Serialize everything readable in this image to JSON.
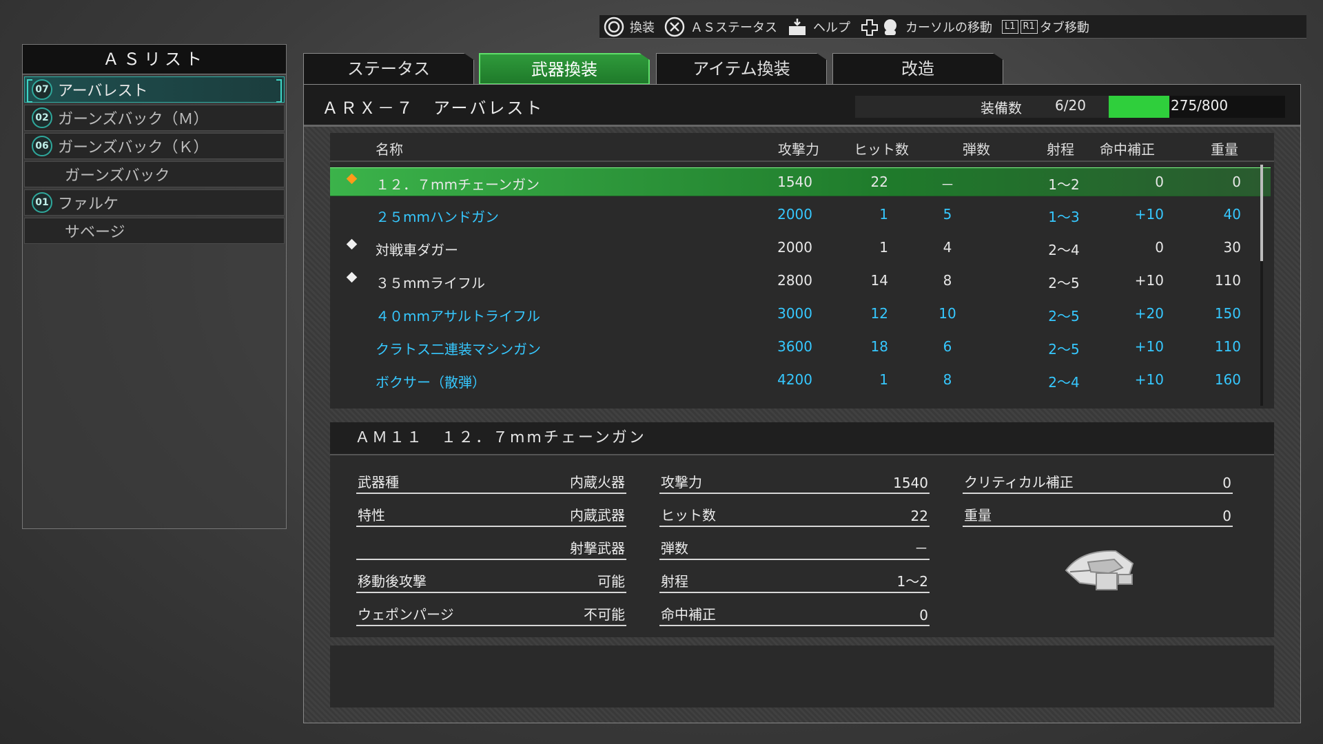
{
  "hints": [
    {
      "icon": "circle-button-icon",
      "label": "換装"
    },
    {
      "icon": "cross-button-icon",
      "label": "ＡＳステータス"
    },
    {
      "icon": "touchpad-icon",
      "label": "ヘルプ"
    },
    {
      "icon": "dpad-stick-icon",
      "label": "カーソルの移動"
    },
    {
      "icon": "shoulder-buttons-icon",
      "l1": "L1",
      "r1": "R1",
      "label": "タブ移動"
    }
  ],
  "as_list": {
    "title": "ＡＳリスト",
    "items": [
      {
        "badge": "07",
        "name": "アーバレスト",
        "selected": true
      },
      {
        "badge": "02",
        "name": "ガーンズバック（Ｍ）",
        "selected": false
      },
      {
        "badge": "06",
        "name": "ガーンズバック（Ｋ）",
        "selected": false
      },
      {
        "badge": "",
        "name": "ガーンズバック",
        "selected": false
      },
      {
        "badge": "01",
        "name": "ファルケ",
        "selected": false
      },
      {
        "badge": "",
        "name": "サベージ",
        "selected": false
      }
    ]
  },
  "tabs": [
    {
      "label": "ステータス",
      "active": false
    },
    {
      "label": "武器換装",
      "active": true
    },
    {
      "label": "アイテム換装",
      "active": false
    },
    {
      "label": "改造",
      "active": false
    }
  ],
  "unit": {
    "name": "ＡＲＸ－７　アーバレスト",
    "capacity_label": "装備数",
    "capacity_count": "6/20",
    "weight_text": "275/800",
    "weight_fraction": 0.34375
  },
  "weapon_table": {
    "headers": {
      "name": "名称",
      "attack": "攻撃力",
      "hits": "ヒット数",
      "ammo": "弾数",
      "range": "射程",
      "accuracy": "命中補正",
      "weight": "重量"
    },
    "rows": [
      {
        "marker": "orange",
        "name": "１２．７mmチェーンガン",
        "attack": "1540",
        "hits": "22",
        "ammo": "－",
        "range": "1～2",
        "accuracy": "0",
        "weight": "0",
        "selected": true,
        "color": "white"
      },
      {
        "marker": "",
        "name": "２５mmハンドガン",
        "attack": "2000",
        "hits": "1",
        "ammo": "5",
        "range": "1～3",
        "accuracy": "+10",
        "weight": "40",
        "selected": false,
        "color": "cyan"
      },
      {
        "marker": "white",
        "name": "対戦車ダガー",
        "attack": "2000",
        "hits": "1",
        "ammo": "4",
        "range": "2～4",
        "accuracy": "0",
        "weight": "30",
        "selected": false,
        "color": "white"
      },
      {
        "marker": "white",
        "name": "３５mmライフル",
        "attack": "2800",
        "hits": "14",
        "ammo": "8",
        "range": "2～5",
        "accuracy": "+10",
        "weight": "110",
        "selected": false,
        "color": "white"
      },
      {
        "marker": "",
        "name": "４０mmアサルトライフル",
        "attack": "3000",
        "hits": "12",
        "ammo": "10",
        "range": "2～5",
        "accuracy": "+20",
        "weight": "150",
        "selected": false,
        "color": "cyan"
      },
      {
        "marker": "",
        "name": "クラトス二連装マシンガン",
        "attack": "3600",
        "hits": "18",
        "ammo": "6",
        "range": "2～5",
        "accuracy": "+10",
        "weight": "110",
        "selected": false,
        "color": "cyan"
      },
      {
        "marker": "",
        "name": "ボクサー（散弾）",
        "attack": "4200",
        "hits": "1",
        "ammo": "8",
        "range": "2～4",
        "accuracy": "+10",
        "weight": "160",
        "selected": false,
        "color": "cyan"
      }
    ]
  },
  "detail": {
    "title": "ＡＭ１１　１２．７mmチェーンガン",
    "col1": [
      {
        "label": "武器種",
        "value": "内蔵火器"
      },
      {
        "label": "特性",
        "value": "内蔵武器"
      },
      {
        "label": "",
        "value": "射撃武器"
      },
      {
        "label": "移動後攻撃",
        "value": "可能"
      },
      {
        "label": "ウェポンパージ",
        "value": "不可能"
      }
    ],
    "col2": [
      {
        "label": "攻撃力",
        "value": "1540"
      },
      {
        "label": "ヒット数",
        "value": "22"
      },
      {
        "label": "弾数",
        "value": "－"
      },
      {
        "label": "射程",
        "value": "1～2"
      },
      {
        "label": "命中補正",
        "value": "0"
      }
    ],
    "col3": [
      {
        "label": "クリティカル補正",
        "value": "0"
      },
      {
        "label": "重量",
        "value": "0"
      }
    ],
    "weapon_icon": "chaingun-head-icon"
  },
  "colors": {
    "accent_green": "#2fcf3c",
    "cyan_text": "#36c8ff",
    "marker_orange": "#ff9a1a",
    "teal_badge": "#2fa89c"
  }
}
